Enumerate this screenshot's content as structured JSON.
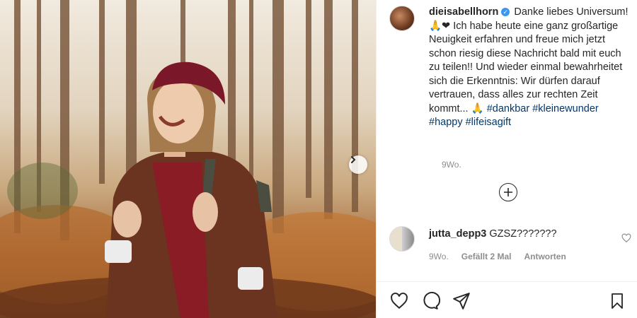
{
  "post": {
    "username": "dieisabellhorn",
    "caption_text": "Danke liebes Universum! 🙏❤ Ich habe heute eine ganz großartige Neuigkeit erfahren und freue mich jetzt schon riesig diese Nachricht bald mit euch zu teilen!! Und wieder einmal bewahrheitet sich die Erkenntnis: Wir dürfen darauf vertrauen, dass alles zur rechten Zeit kommt... 🙏",
    "hashtags": [
      "#dankbar",
      "#kleinewunder",
      "#happy",
      "#lifeisagift"
    ],
    "timestamp": "9Wo."
  },
  "comment": {
    "username": "jutta_depp3",
    "text": "GZSZ???????",
    "timestamp": "9Wo.",
    "likes": "Gefällt 2 Mal",
    "reply_label": "Antworten"
  },
  "icons": {
    "verified": "verified-badge-icon",
    "next": "chevron-right-icon",
    "load_more": "plus-circle-icon",
    "like": "heart-icon",
    "comment": "comment-icon",
    "share": "paper-plane-icon",
    "save": "bookmark-icon"
  },
  "colors": {
    "hashtag": "#00376b",
    "muted": "#8e8e8e",
    "verified": "#3897f0",
    "text": "#262626"
  }
}
